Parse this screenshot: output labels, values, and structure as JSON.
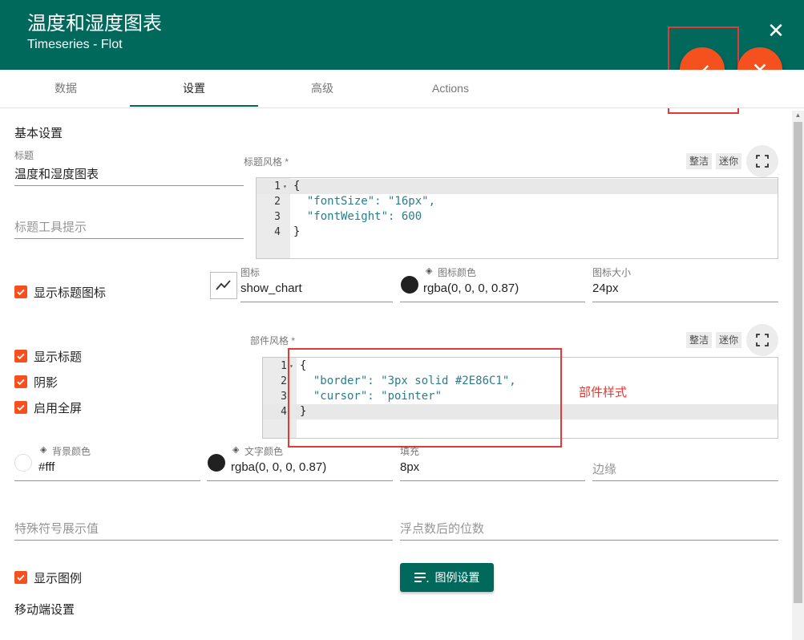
{
  "header": {
    "title": "温度和湿度图表",
    "subtitle": "Timeseries - Flot",
    "close_icon": "close-icon",
    "confirm_icon": "check-icon",
    "cancel_icon": "close-icon"
  },
  "tabs": [
    {
      "label": "数据",
      "active": false
    },
    {
      "label": "设置",
      "active": true
    },
    {
      "label": "高级",
      "active": false
    },
    {
      "label": "Actions",
      "active": false
    }
  ],
  "form": {
    "basic_section": "基本设置",
    "title_field": {
      "label": "标题",
      "value": "温度和湿度图表"
    },
    "title_tooltip_field": {
      "placeholder": "标题工具提示"
    },
    "title_style": {
      "label": "标题风格 *",
      "btn_tidy": "整洁",
      "btn_mini": "迷你",
      "line_numbers": [
        "1",
        "2",
        "3",
        "4"
      ],
      "lines": [
        "{",
        "  \"fontSize\": \"16px\",",
        "  \"fontWeight\": 600",
        "}"
      ]
    },
    "show_title_icon": {
      "label": "显示标题图标",
      "checked": true
    },
    "icon_field": {
      "label": "图标",
      "value": "show_chart"
    },
    "icon_color_field": {
      "label": "图标颜色",
      "value": "rgba(0, 0, 0, 0.87)",
      "swatch": "#212121"
    },
    "icon_size_field": {
      "label": "图标大小",
      "value": "24px"
    },
    "widget_style": {
      "label": "部件风格 *",
      "btn_tidy": "整洁",
      "btn_mini": "迷你",
      "line_numbers": [
        "1",
        "2",
        "3",
        "4"
      ],
      "lines": [
        "{",
        "  \"border\": \"3px solid #2E86C1\",",
        "  \"cursor\": \"pointer\"",
        "}"
      ],
      "annotation": "部件样式"
    },
    "show_title": {
      "label": "显示标题",
      "checked": true
    },
    "shadow": {
      "label": "阴影",
      "checked": true
    },
    "enable_fullscreen": {
      "label": "启用全屏",
      "checked": true
    },
    "bg_color_field": {
      "label": "背景颜色",
      "value": "#fff",
      "swatch": "#ffffff"
    },
    "text_color_field": {
      "label": "文字颜色",
      "value": "rgba(0, 0, 0, 0.87)",
      "swatch": "#212121"
    },
    "padding_field": {
      "label": "填充",
      "value": "8px"
    },
    "margin_field": {
      "placeholder": "边缘"
    },
    "special_symbol_field": {
      "placeholder": "特殊符号展示值"
    },
    "decimals_field": {
      "placeholder": "浮点数后的位数"
    },
    "show_legend": {
      "label": "显示图例",
      "checked": true
    },
    "legend_settings_btn": "图例设置",
    "mobile_section": "移动端设置"
  },
  "colors": {
    "primary": "#00695c",
    "accent": "#f4511e",
    "highlight": "#e53935"
  }
}
